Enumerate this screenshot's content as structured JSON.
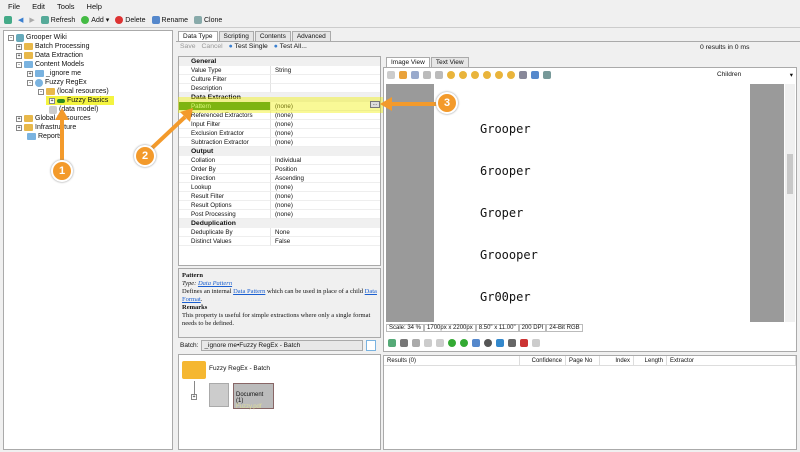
{
  "menu": [
    "File",
    "Edit",
    "Tools",
    "Help"
  ],
  "toolbar": {
    "refresh": "Refresh",
    "add": "Add",
    "delete": "Delete",
    "rename": "Rename",
    "clone": "Clone"
  },
  "tree": {
    "root": "Grooper Wiki",
    "items": [
      "Batch Processing",
      "Data Extraction",
      "Content Models",
      "_ignore me",
      "Fuzzy RegEx",
      "(local resources)",
      "Fuzzy Basics",
      "(data model)",
      "Global Resources",
      "Infrastructure",
      "Reports"
    ]
  },
  "tabs": [
    "Data Type",
    "Scripting",
    "Contents",
    "Advanced"
  ],
  "subtoolbar": {
    "save": "Save",
    "cancel": "Cancel",
    "test_single": "Test Single",
    "test_all": "Test All..."
  },
  "properties": [
    {
      "category": "General",
      "rows": [
        [
          "Value Type",
          "String"
        ],
        [
          "Culture Filter",
          ""
        ],
        [
          "Description",
          ""
        ]
      ]
    },
    {
      "category": "Data Extraction",
      "rows": [
        [
          "Pattern",
          "(none)"
        ],
        [
          "Referenced Extractors",
          "(none)"
        ],
        [
          "Input Filter",
          "(none)"
        ],
        [
          "Exclusion Extractor",
          "(none)"
        ],
        [
          "Subtraction Extractor",
          "(none)"
        ]
      ]
    },
    {
      "category": "Output",
      "rows": [
        [
          "Collation",
          "Individual"
        ],
        [
          "Order By",
          "Position"
        ],
        [
          "Direction",
          "Ascending"
        ],
        [
          "Lookup",
          "(none)"
        ],
        [
          "Result Filter",
          "(none)"
        ],
        [
          "Result Options",
          "(none)"
        ],
        [
          "Post Processing",
          "(none)"
        ]
      ]
    },
    {
      "category": "Deduplication",
      "rows": [
        [
          "Deduplicate By",
          "None"
        ],
        [
          "Distinct Values",
          "False"
        ]
      ]
    }
  ],
  "help": {
    "title": "Pattern",
    "type_label": "Type:",
    "type_link": "Data Pattern",
    "desc_pre": "Defines an internal ",
    "desc_link": "Data Pattern",
    "desc_mid": " which can be used in place of a child ",
    "desc_link2": "Data Format",
    "desc_end": ".",
    "remarks": "Remarks",
    "remarks_text": "This property is useful for simple extractions where only a single format needs to be defined."
  },
  "batch": {
    "label": "Batch:",
    "value": "_ignore me•Fuzzy RegEx - Batch",
    "folder": "Fuzzy RegEx - Batch",
    "document": "Document (1)",
    "file": "Fuzzy.pdf"
  },
  "results_status": "0 results in 0 ms",
  "view_tabs": [
    "Image View",
    "Text View"
  ],
  "children_select": "Children",
  "image_lines": [
    "Grooper",
    "6rooper",
    "Groper",
    "Groooper",
    "Gr00per"
  ],
  "status_bar": [
    "Scale: 34 %",
    "1700px x 2200px",
    "8.50\" x 11.00\"",
    "200 DPI",
    "24-Bit RGB"
  ],
  "results_columns": [
    "Results (0)",
    "Confidence",
    "Page No",
    "Index",
    "Length",
    "Extractor"
  ],
  "callouts": [
    "1",
    "2",
    "3"
  ],
  "colors": {
    "callout": "#f39a2b",
    "highlight": "#f0f000",
    "selected": "#2e8b1e"
  }
}
